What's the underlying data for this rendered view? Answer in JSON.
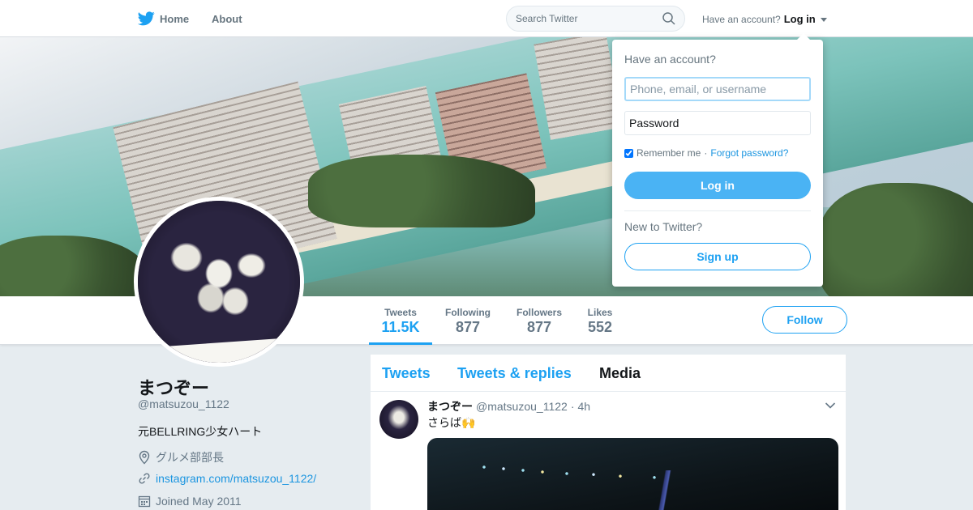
{
  "nav": {
    "home_label": "Home",
    "about_label": "About",
    "search_placeholder": "Search Twitter",
    "have_account_text": "Have an account?",
    "login_label": "Log in"
  },
  "login_dropdown": {
    "title": "Have an account?",
    "username_placeholder": "Phone, email, or username",
    "password_placeholder": "Password",
    "remember_label": "Remember me",
    "separator": "·",
    "forgot_label": "Forgot password?",
    "login_button": "Log in",
    "new_label": "New to Twitter?",
    "signup_button": "Sign up"
  },
  "stats": [
    {
      "label": "Tweets",
      "value": "11.5K"
    },
    {
      "label": "Following",
      "value": "877"
    },
    {
      "label": "Followers",
      "value": "877"
    },
    {
      "label": "Likes",
      "value": "552"
    }
  ],
  "follow_button": "Follow",
  "profile": {
    "name": "まつぞー",
    "handle": "@matsuzou_1122",
    "bio": "元BELLRING少女ハート",
    "location": "グルメ部部長",
    "url": "instagram.com/matsuzou_1122/",
    "joined": "Joined May 2011"
  },
  "timeline": {
    "tabs": [
      "Tweets",
      "Tweets & replies",
      "Media"
    ]
  },
  "tweet": {
    "name": "まつぞー",
    "handle": "@matsuzou_1122",
    "separator": "·",
    "time": "4h",
    "text": "さらば🙌"
  },
  "colors": {
    "brand": "#1da1f2",
    "login_button": "#4ab3f4",
    "text": "#14171a",
    "secondary": "#657786"
  },
  "icons": {
    "logo": "twitter-bird-icon",
    "search": "search-icon",
    "location": "location-pin-icon",
    "link": "link-icon",
    "calendar": "calendar-icon",
    "chevron": "chevron-down-icon"
  }
}
